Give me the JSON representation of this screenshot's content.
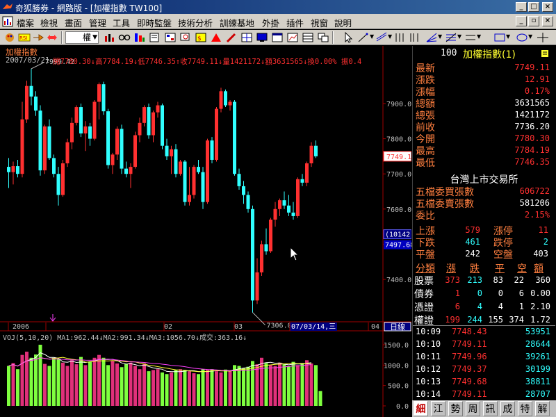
{
  "window": {
    "title": "奇狐勝券 - 網路版 - [加權指數 TW100]",
    "colors": {
      "up": "#ff3030",
      "down": "#30ffff",
      "vol_up": "#e0307a",
      "vol_down": "#7fff3f",
      "label": "#ff7f3f"
    }
  },
  "menu": {
    "items": [
      "檔案",
      "檢視",
      "畫面",
      "管理",
      "工具",
      "即時監盤",
      "技術分析",
      "訓練基地",
      "外掛",
      "插件",
      "視窗",
      "說明"
    ]
  },
  "toolbar": {
    "mode_label": "權"
  },
  "chart": {
    "name": "加權指數",
    "date": "2007/03/21",
    "ohlc_line": "開7780.30↓高7784.19↓低7746.35↑收7749.11↓量1421172↓額3631565↓換0.00% 振0.4",
    "vol_header": "VOJ(5,10,20) MA1:962.44↓MA2:991.34↓MA3:1056.70↓成交:363.16↓",
    "high_annotation": "7999.42",
    "low_annotation": "7306.07",
    "price_tag": "7749.1",
    "cursor_count": "(10142)",
    "cursor_price": "7497.68",
    "time_axis": [
      "2006",
      "02",
      "03",
      "07/03/14,三",
      "04"
    ],
    "period_button": "日線"
  },
  "chart_data": {
    "type": "candlestick",
    "price_axis": {
      "ticks": [
        7400,
        7500,
        7600,
        7700,
        7800,
        7900
      ],
      "labels": [
        "7400.00",
        "7500.00",
        "7600.00",
        "7700.00",
        "7800.00",
        "7900.00"
      ]
    },
    "volume_axis": {
      "ticks": [
        0,
        500,
        1000,
        1500
      ],
      "labels": [
        "0.0",
        "500.0",
        "1000.0",
        "1500.0"
      ]
    },
    "candles": [
      {
        "o": 7720,
        "h": 7745,
        "l": 7660,
        "c": 7705
      },
      {
        "o": 7705,
        "h": 7735,
        "l": 7670,
        "c": 7722
      },
      {
        "o": 7722,
        "h": 7740,
        "l": 7690,
        "c": 7700
      },
      {
        "o": 7700,
        "h": 7905,
        "l": 7690,
        "c": 7855
      },
      {
        "o": 7855,
        "h": 7965,
        "l": 7845,
        "c": 7950
      },
      {
        "o": 7950,
        "h": 7999,
        "l": 7895,
        "c": 7920
      },
      {
        "o": 7920,
        "h": 7935,
        "l": 7865,
        "c": 7880
      },
      {
        "o": 7880,
        "h": 7895,
        "l": 7695,
        "c": 7710
      },
      {
        "o": 7710,
        "h": 7840,
        "l": 7700,
        "c": 7835
      },
      {
        "o": 7835,
        "h": 7855,
        "l": 7740,
        "c": 7745
      },
      {
        "o": 7745,
        "h": 7755,
        "l": 7690,
        "c": 7700
      },
      {
        "o": 7700,
        "h": 7720,
        "l": 7610,
        "c": 7640
      },
      {
        "o": 7640,
        "h": 7740,
        "l": 7635,
        "c": 7730
      },
      {
        "o": 7730,
        "h": 7800,
        "l": 7720,
        "c": 7790
      },
      {
        "o": 7790,
        "h": 7860,
        "l": 7770,
        "c": 7845
      },
      {
        "o": 7845,
        "h": 7895,
        "l": 7838,
        "c": 7890
      },
      {
        "o": 7890,
        "h": 7900,
        "l": 7805,
        "c": 7815
      },
      {
        "o": 7815,
        "h": 7850,
        "l": 7765,
        "c": 7835
      },
      {
        "o": 7835,
        "h": 7845,
        "l": 7780,
        "c": 7800
      },
      {
        "o": 7800,
        "h": 7910,
        "l": 7795,
        "c": 7905
      },
      {
        "o": 7905,
        "h": 7960,
        "l": 7855,
        "c": 7955
      },
      {
        "o": 7955,
        "h": 7962,
        "l": 7868,
        "c": 7878
      },
      {
        "o": 7878,
        "h": 7885,
        "l": 7715,
        "c": 7725
      },
      {
        "o": 7725,
        "h": 7760,
        "l": 7700,
        "c": 7755
      },
      {
        "o": 7755,
        "h": 7835,
        "l": 7740,
        "c": 7828
      },
      {
        "o": 7828,
        "h": 7840,
        "l": 7700,
        "c": 7715
      },
      {
        "o": 7715,
        "h": 7735,
        "l": 7690,
        "c": 7700
      },
      {
        "o": 7700,
        "h": 7730,
        "l": 7660,
        "c": 7720
      },
      {
        "o": 7720,
        "h": 7820,
        "l": 7715,
        "c": 7810
      },
      {
        "o": 7810,
        "h": 7860,
        "l": 7790,
        "c": 7845
      },
      {
        "o": 7845,
        "h": 7895,
        "l": 7835,
        "c": 7890
      },
      {
        "o": 7890,
        "h": 7900,
        "l": 7800,
        "c": 7810
      },
      {
        "o": 7810,
        "h": 7880,
        "l": 7790,
        "c": 7875
      },
      {
        "o": 7875,
        "h": 7905,
        "l": 7860,
        "c": 7895
      },
      {
        "o": 7895,
        "h": 7900,
        "l": 7770,
        "c": 7780
      },
      {
        "o": 7780,
        "h": 7800,
        "l": 7740,
        "c": 7750
      },
      {
        "o": 7750,
        "h": 7780,
        "l": 7700,
        "c": 7770
      },
      {
        "o": 7770,
        "h": 7785,
        "l": 7690,
        "c": 7700
      },
      {
        "o": 7700,
        "h": 7740,
        "l": 7695,
        "c": 7735
      },
      {
        "o": 7735,
        "h": 7740,
        "l": 7610,
        "c": 7620
      },
      {
        "o": 7620,
        "h": 7720,
        "l": 7610,
        "c": 7640
      },
      {
        "o": 7640,
        "h": 7725,
        "l": 7630,
        "c": 7720
      },
      {
        "o": 7720,
        "h": 7740,
        "l": 7700,
        "c": 7705
      },
      {
        "o": 7705,
        "h": 7720,
        "l": 7600,
        "c": 7620
      },
      {
        "o": 7620,
        "h": 7800,
        "l": 7615,
        "c": 7795
      },
      {
        "o": 7795,
        "h": 7805,
        "l": 7730,
        "c": 7740
      },
      {
        "o": 7740,
        "h": 7890,
        "l": 7735,
        "c": 7885
      },
      {
        "o": 7885,
        "h": 7945,
        "l": 7875,
        "c": 7935
      },
      {
        "o": 7935,
        "h": 7940,
        "l": 7890,
        "c": 7895
      },
      {
        "o": 7895,
        "h": 7910,
        "l": 7880,
        "c": 7905
      },
      {
        "o": 7905,
        "h": 7910,
        "l": 7695,
        "c": 7700
      },
      {
        "o": 7700,
        "h": 7715,
        "l": 7655,
        "c": 7665
      },
      {
        "o": 7665,
        "h": 7680,
        "l": 7615,
        "c": 7640
      },
      {
        "o": 7640,
        "h": 7650,
        "l": 7590,
        "c": 7600
      },
      {
        "o": 7600,
        "h": 7610,
        "l": 7306,
        "c": 7340
      },
      {
        "o": 7340,
        "h": 7460,
        "l": 7330,
        "c": 7420
      },
      {
        "o": 7420,
        "h": 7510,
        "l": 7410,
        "c": 7500
      },
      {
        "o": 7500,
        "h": 7545,
        "l": 7470,
        "c": 7480
      },
      {
        "o": 7480,
        "h": 7575,
        "l": 7475,
        "c": 7570
      },
      {
        "o": 7570,
        "h": 7620,
        "l": 7550,
        "c": 7600
      },
      {
        "o": 7600,
        "h": 7630,
        "l": 7580,
        "c": 7625
      },
      {
        "o": 7625,
        "h": 7650,
        "l": 7600,
        "c": 7610
      },
      {
        "o": 7610,
        "h": 7640,
        "l": 7580,
        "c": 7590
      },
      {
        "o": 7590,
        "h": 7620,
        "l": 7570,
        "c": 7580
      },
      {
        "o": 7580,
        "h": 7690,
        "l": 7575,
        "c": 7685
      },
      {
        "o": 7685,
        "h": 7700,
        "l": 7665,
        "c": 7675
      },
      {
        "o": 7675,
        "h": 7735,
        "l": 7665,
        "c": 7730
      },
      {
        "o": 7730,
        "h": 7790,
        "l": 7720,
        "c": 7780
      },
      {
        "o": 7780,
        "h": 7795,
        "l": 7745,
        "c": 7750
      }
    ],
    "volumes": [
      980,
      1050,
      900,
      1250,
      1330,
      1180,
      1260,
      1500,
      1030,
      980,
      1180,
      1150,
      1060,
      980,
      1120,
      1020,
      1200,
      1000,
      1080,
      1180,
      1250,
      1180,
      1000,
      1100,
      1040,
      950,
      1030,
      1060,
      980,
      900,
      1040,
      850,
      880,
      900,
      820,
      780,
      820,
      880,
      900,
      880,
      850,
      800,
      780,
      900,
      880,
      900,
      850,
      820,
      890,
      850,
      1000,
      980,
      920,
      960,
      1100,
      1020,
      1180,
      1050,
      1000,
      980,
      1060,
      1020,
      980,
      1080,
      1000,
      1050,
      1120,
      1040,
      1000,
      363
    ]
  },
  "quote": {
    "header_id": "100",
    "header_name": "加權指數(1)",
    "rows": [
      {
        "label": "最新",
        "value": "7749.11",
        "color": "#ff3030"
      },
      {
        "label": "漲跌",
        "value": "12.91",
        "color": "#ff3030"
      },
      {
        "label": "漲幅",
        "value": "0.17%",
        "color": "#ff3030"
      },
      {
        "label": "總額",
        "value": "3631565",
        "color": "#ffffff"
      },
      {
        "label": "總張",
        "value": "1421172",
        "color": "#ffffff"
      },
      {
        "label": "前收",
        "value": "7736.20",
        "color": "#ffffff"
      },
      {
        "label": "今開",
        "value": "7780.30",
        "color": "#ff3030"
      },
      {
        "label": "最高",
        "value": "7784.19",
        "color": "#ff3030"
      },
      {
        "label": "最低",
        "value": "7746.35",
        "color": "#ff3030"
      }
    ],
    "exchange": "台灣上市交易所",
    "book_rows": [
      {
        "label": "五檔委買張數",
        "value": "606722",
        "color": "#ff3030"
      },
      {
        "label": "五檔委賣張數",
        "value": "581206",
        "color": "#ffffff"
      },
      {
        "label": "委比",
        "value": "2.15%",
        "color": "#ff3030"
      }
    ],
    "breadth": [
      {
        "l1": "上漲",
        "v1": "579",
        "c1": "#ff3030",
        "l2": "漲停",
        "v2": "11",
        "c2": "#ff3030"
      },
      {
        "l1": "下跌",
        "v1": "461",
        "c1": "#30ffff",
        "l2": "跌停",
        "v2": "2",
        "c2": "#30ffff"
      },
      {
        "l1": "平盤",
        "v1": "242",
        "c1": "#ffffff",
        "l2": "空盤",
        "v2": "403",
        "c2": "#ffffff"
      }
    ],
    "class_header": [
      "分類",
      "漲",
      "跌",
      "平",
      "空",
      "額"
    ],
    "classes": [
      {
        "name": "股票",
        "up": "373",
        "down": "213",
        "flat": "83",
        "empty": "22",
        "amt": "360"
      },
      {
        "name": "債券",
        "up": "1",
        "down": "0",
        "flat": "0",
        "empty": "6",
        "amt": "0.00"
      },
      {
        "name": "憑證",
        "up": "6",
        "down": "4",
        "flat": "4",
        "empty": "1",
        "amt": "2.10"
      },
      {
        "name": "權證",
        "up": "199",
        "down": "244",
        "flat": "155",
        "empty": "374",
        "amt": "1.72"
      }
    ],
    "ticks": [
      {
        "time": "10:09",
        "price": "7748.43",
        "vol": "53951"
      },
      {
        "time": "10:10",
        "price": "7749.11",
        "vol": "28644"
      },
      {
        "time": "10:11",
        "price": "7749.96",
        "vol": "39261"
      },
      {
        "time": "10:12",
        "price": "7749.37",
        "vol": "30199"
      },
      {
        "time": "10:13",
        "price": "7749.68",
        "vol": "38811"
      },
      {
        "time": "10:14",
        "price": "7749.11",
        "vol": "28707"
      }
    ],
    "tabs": [
      "細",
      "江",
      "勢",
      "周",
      "訊",
      "成",
      "特",
      "解"
    ]
  }
}
